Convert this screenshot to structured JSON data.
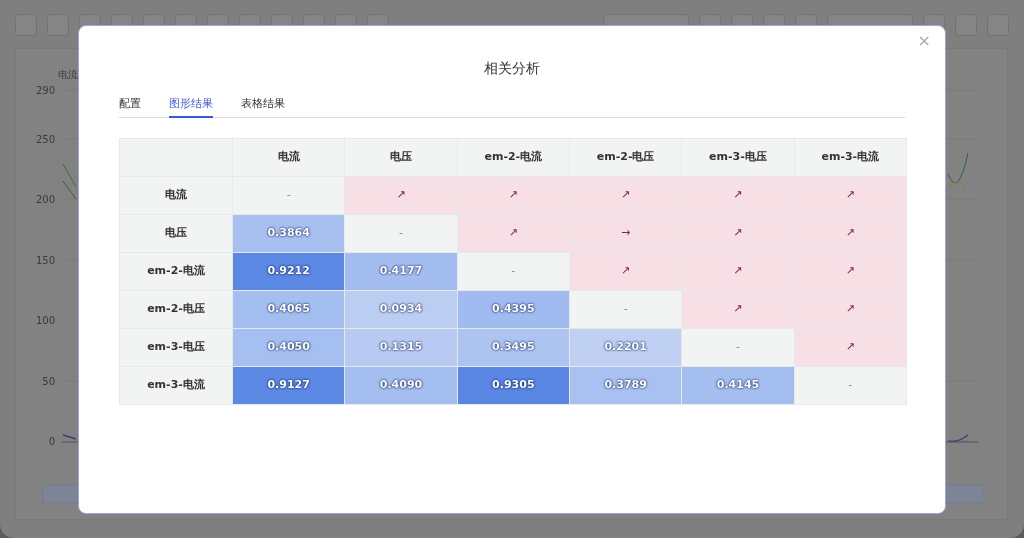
{
  "background_chart": {
    "axis_title": "电流",
    "data_zoom": {
      "level": 1
    },
    "tick_labels": [
      "290",
      "250",
      "200",
      "150",
      "100",
      "50",
      "0"
    ]
  },
  "dialog": {
    "title": "相关分析",
    "close": "×",
    "tabs": [
      {
        "label": "配置",
        "selected": false
      },
      {
        "label": "图形结果",
        "selected": true
      },
      {
        "label": "表格结果",
        "selected": false
      }
    ],
    "matrix": {
      "columns": [
        "电流",
        "电压",
        "em-2-电流",
        "em-2-电压",
        "em-3-电压",
        "em-3-电流"
      ],
      "rows": [
        {
          "label": "电流",
          "cells": [
            {
              "kind": "diagonal",
              "text": "-"
            },
            {
              "kind": "arrow",
              "text": "↗"
            },
            {
              "kind": "arrow",
              "text": "↗"
            },
            {
              "kind": "arrow",
              "text": "↗"
            },
            {
              "kind": "arrow",
              "text": "↗"
            },
            {
              "kind": "arrow",
              "text": "↗"
            }
          ]
        },
        {
          "label": "电压",
          "cells": [
            {
              "kind": "value",
              "text": "0.3864",
              "color": "#a7c0f0"
            },
            {
              "kind": "diagonal",
              "text": "-"
            },
            {
              "kind": "arrow",
              "text": "↗"
            },
            {
              "kind": "arrow",
              "text": "→"
            },
            {
              "kind": "arrow",
              "text": "↗"
            },
            {
              "kind": "arrow",
              "text": "↗"
            }
          ]
        },
        {
          "label": "em-2-电流",
          "cells": [
            {
              "kind": "value",
              "text": "0.9212",
              "color": "#5a88e3"
            },
            {
              "kind": "value",
              "text": "0.4177",
              "color": "#a3bdf0"
            },
            {
              "kind": "diagonal",
              "text": "-"
            },
            {
              "kind": "arrow",
              "text": "↗"
            },
            {
              "kind": "arrow",
              "text": "↗"
            },
            {
              "kind": "arrow",
              "text": "↗"
            }
          ]
        },
        {
          "label": "em-2-电压",
          "cells": [
            {
              "kind": "value",
              "text": "0.4065",
              "color": "#a4bef0"
            },
            {
              "kind": "value",
              "text": "0.0934",
              "color": "#bccdf2"
            },
            {
              "kind": "value",
              "text": "0.4395",
              "color": "#a0bbef"
            },
            {
              "kind": "diagonal",
              "text": "-"
            },
            {
              "kind": "arrow",
              "text": "↗"
            },
            {
              "kind": "arrow",
              "text": "↗"
            }
          ]
        },
        {
          "label": "em-3-电压",
          "cells": [
            {
              "kind": "value",
              "text": "0.4050",
              "color": "#a5bff0"
            },
            {
              "kind": "value",
              "text": "0.1315",
              "color": "#b8caf1"
            },
            {
              "kind": "value",
              "text": "0.3495",
              "color": "#adc4f1"
            },
            {
              "kind": "value",
              "text": "0.2201",
              "color": "#bfd0f3"
            },
            {
              "kind": "diagonal",
              "text": "-"
            },
            {
              "kind": "arrow",
              "text": "↗"
            }
          ]
        },
        {
          "label": "em-3-电流",
          "cells": [
            {
              "kind": "value",
              "text": "0.9127",
              "color": "#5b89e3"
            },
            {
              "kind": "value",
              "text": "0.4090",
              "color": "#a4bef0"
            },
            {
              "kind": "value",
              "text": "0.9305",
              "color": "#5987e3"
            },
            {
              "kind": "value",
              "text": "0.3789",
              "color": "#a8c1f0"
            },
            {
              "kind": "value",
              "text": "0.4145",
              "color": "#a4bef0"
            },
            {
              "kind": "diagonal",
              "text": "-"
            }
          ]
        }
      ]
    }
  }
}
